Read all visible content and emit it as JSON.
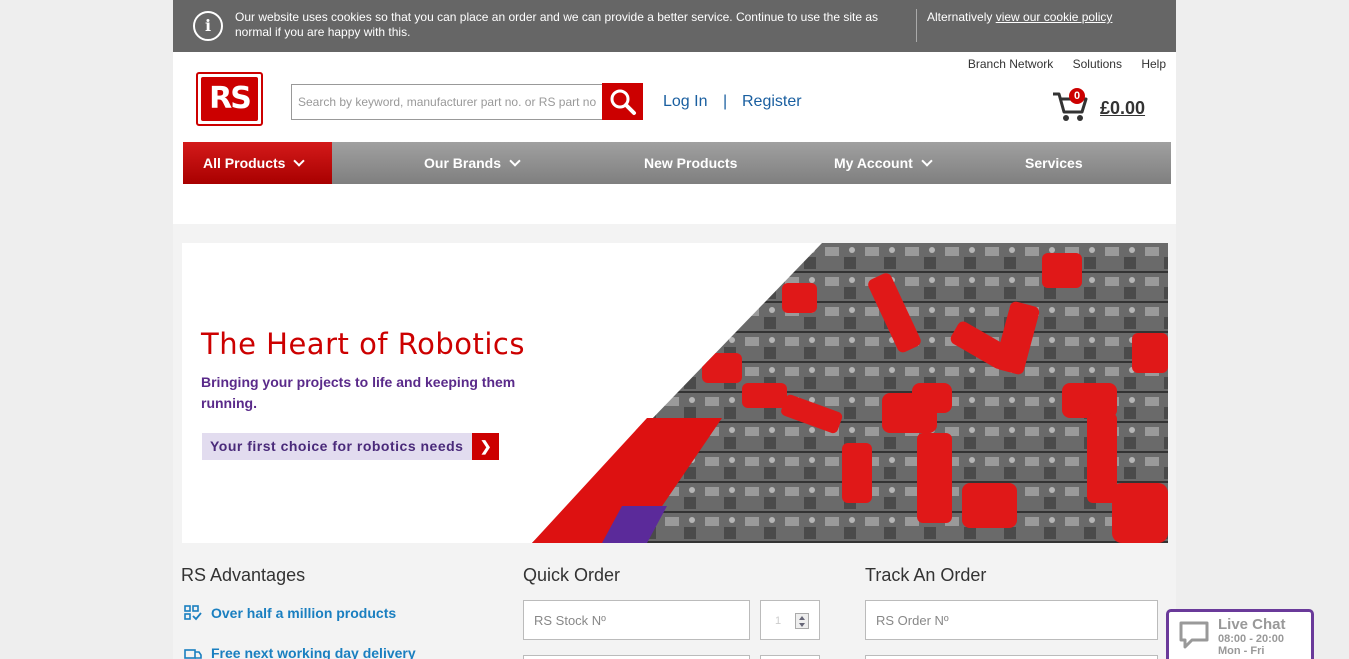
{
  "cookie_bar": {
    "message": "Our website uses cookies so that you can place an order and we can provide a better service. Continue to use the site as normal if you are happy with this.",
    "alternative_prefix": "Alternatively ",
    "policy_link": "view our cookie policy",
    "icon": "info-icon"
  },
  "header": {
    "logo_text": "RS",
    "top_links": [
      "Branch Network",
      "Solutions",
      "Help"
    ],
    "search": {
      "placeholder": "Search by keyword, manufacturer part no. or RS part no",
      "button_icon": "search-icon"
    },
    "login": "Log In",
    "separator": "|",
    "register": "Register",
    "cart": {
      "count": "0",
      "total": "£0.00",
      "icon": "cart-icon"
    }
  },
  "nav": {
    "items": [
      {
        "label": "All Products",
        "dropdown": true
      },
      {
        "label": "Our Brands",
        "dropdown": true
      },
      {
        "label": "New Products",
        "dropdown": false
      },
      {
        "label": "My Account",
        "dropdown": true
      },
      {
        "label": "Services",
        "dropdown": false
      }
    ]
  },
  "hero": {
    "title": "The Heart of Robotics",
    "subtitle": "Bringing your projects to life and keeping them running.",
    "cta": "Your first choice for robotics needs",
    "cta_arrow": "❯"
  },
  "advantages": {
    "title": "RS Advantages",
    "items": [
      "Over half a million products",
      "Free next working day delivery"
    ]
  },
  "quick_order": {
    "title": "Quick Order",
    "stock_placeholder": "RS Stock Nº",
    "qty_value": "1"
  },
  "track_order": {
    "title": "Track An Order",
    "order_placeholder": "RS Order Nº"
  },
  "live_chat": {
    "title": "Live Chat",
    "hours": "08:00 - 20:00",
    "days": "Mon - Fri"
  },
  "colors": {
    "brand_red": "#cc0000",
    "accent_purple": "#5a2a8a",
    "link_blue": "#1a5fa0"
  }
}
